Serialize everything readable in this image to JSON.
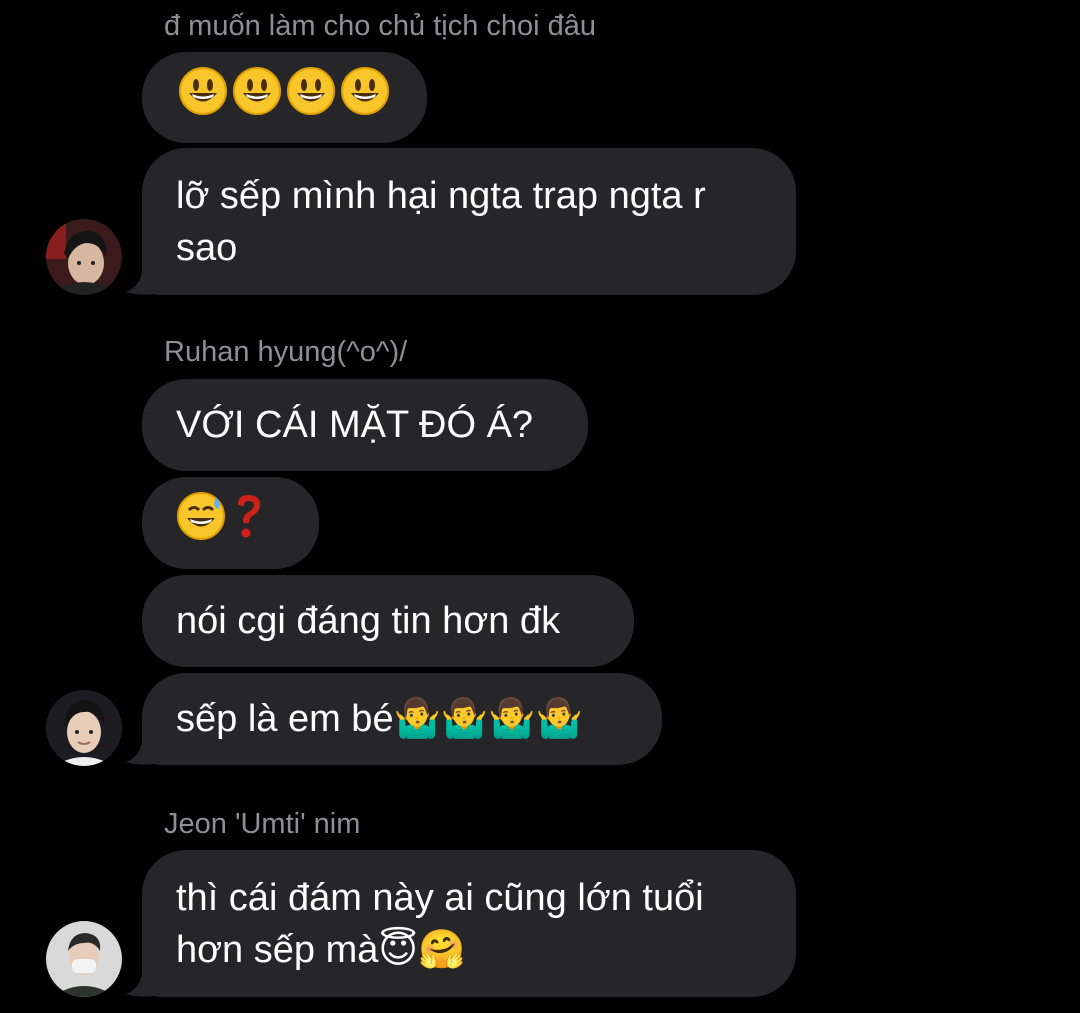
{
  "messages": {
    "m1_sender": "đ muốn làm cho chủ tịch choi đâu",
    "m1_bubble1_emoji_label": "😃😃😃😃",
    "m1_bubble2": "lỡ sếp mình hại ngta trap ngta r\nsao",
    "m2_sender": "Ruhan hyung(^o^)/",
    "m2_bubble1": "VỚI CÁI MẶT ĐÓ Á?",
    "m2_bubble2_emoji_label": "😅❓",
    "m2_bubble3": "nói cgi đáng tin hơn đk",
    "m2_bubble4": "sếp là em bé🤷‍♂️🤷‍♂️🤷‍♂️🤷‍♂️",
    "m3_sender": "Jeon 'Umti' nim",
    "m3_bubble1": "thì cái đám này ai cũng lớn tuổi\nhơn sếp mà😇🤗"
  },
  "icons": {
    "smiley": "grinning-face-with-big-eyes-icon",
    "sweat": "grinning-face-with-sweat-icon",
    "question": "red-question-mark-icon"
  },
  "colors": {
    "background": "#000000",
    "bubble": "#262628",
    "sender_text": "#8e8e93",
    "message_text": "#ffffff"
  }
}
